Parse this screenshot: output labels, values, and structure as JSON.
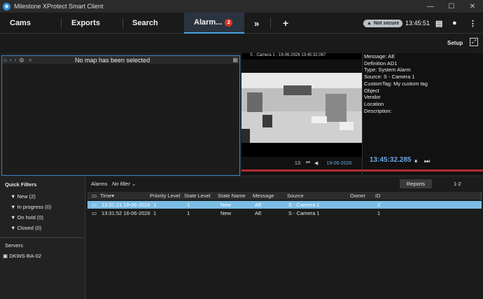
{
  "window": {
    "title": "Milestone XProtect Smart Client",
    "min": "—",
    "max": "☐",
    "close": "✕"
  },
  "nav": {
    "tabs": [
      "Cams",
      "Exports",
      "Search",
      "Alarm..."
    ],
    "alarm_badge": "2",
    "more": "»",
    "add": "+",
    "security": "Not secure",
    "time": "13:45:51"
  },
  "toolbar": {
    "setup": "Setup"
  },
  "map": {
    "message": "No map has been selected"
  },
  "camera": {
    "title": "S - Camera 1 - 19-06-2026 13:45:32.067",
    "date": "19-06-2026",
    "time_short": "13:"
  },
  "meta_lines": [
    "Message: AE",
    "Definition AD1",
    "Type: System Alarm",
    "Source: S - Camera 1",
    "CustomTag: My custom tag",
    "Object",
    "Vendor",
    "Location",
    "Description:"
  ],
  "playback": {
    "time": "13:45:32.285"
  },
  "filters": {
    "title": "Quick Filters",
    "items": [
      "New (2)",
      "In progress (0)",
      "On hold (0)",
      "Closed (0)"
    ],
    "servers_title": "Servers",
    "server": "DKWS-BA-02"
  },
  "alarms": {
    "label": "Alarms",
    "filter": "No filter",
    "reports": "Reports",
    "page": "1-2",
    "columns": [
      "Time",
      "Priority Level",
      "State Level",
      "State Name",
      "Message",
      "Source",
      "Owner",
      "ID"
    ],
    "rows": [
      [
        "13:31:21 19-06-2026",
        "1",
        "1",
        "New",
        "AE",
        "S - Camera 1",
        "",
        "2"
      ],
      [
        "13:31:52 16-06-2026",
        "1",
        "1",
        "New",
        "AE",
        "S - Camera 1",
        "",
        "1"
      ]
    ]
  }
}
